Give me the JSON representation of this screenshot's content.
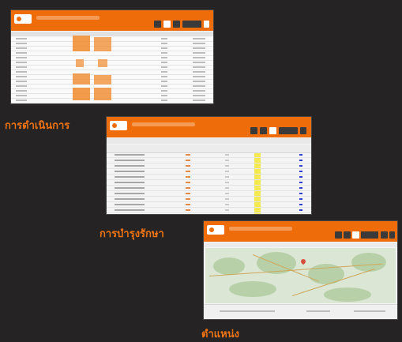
{
  "captions": {
    "operations": "การดำเนินการ",
    "maintenance": "การบำรุงรักษา",
    "location": "ตำแหน่ง"
  },
  "icons": {
    "toolbar_dark": "toolbar-button-icon",
    "toolbar_white": "toolbar-button-active-icon",
    "map_pin": "map-pin-icon"
  },
  "colors": {
    "header": "#ef6c0a",
    "background": "#262324",
    "caption": "#f07312",
    "highlight_column": "#f4e94f",
    "map_marker": "#d84c3a",
    "check_blue": "#2b3fd3"
  }
}
